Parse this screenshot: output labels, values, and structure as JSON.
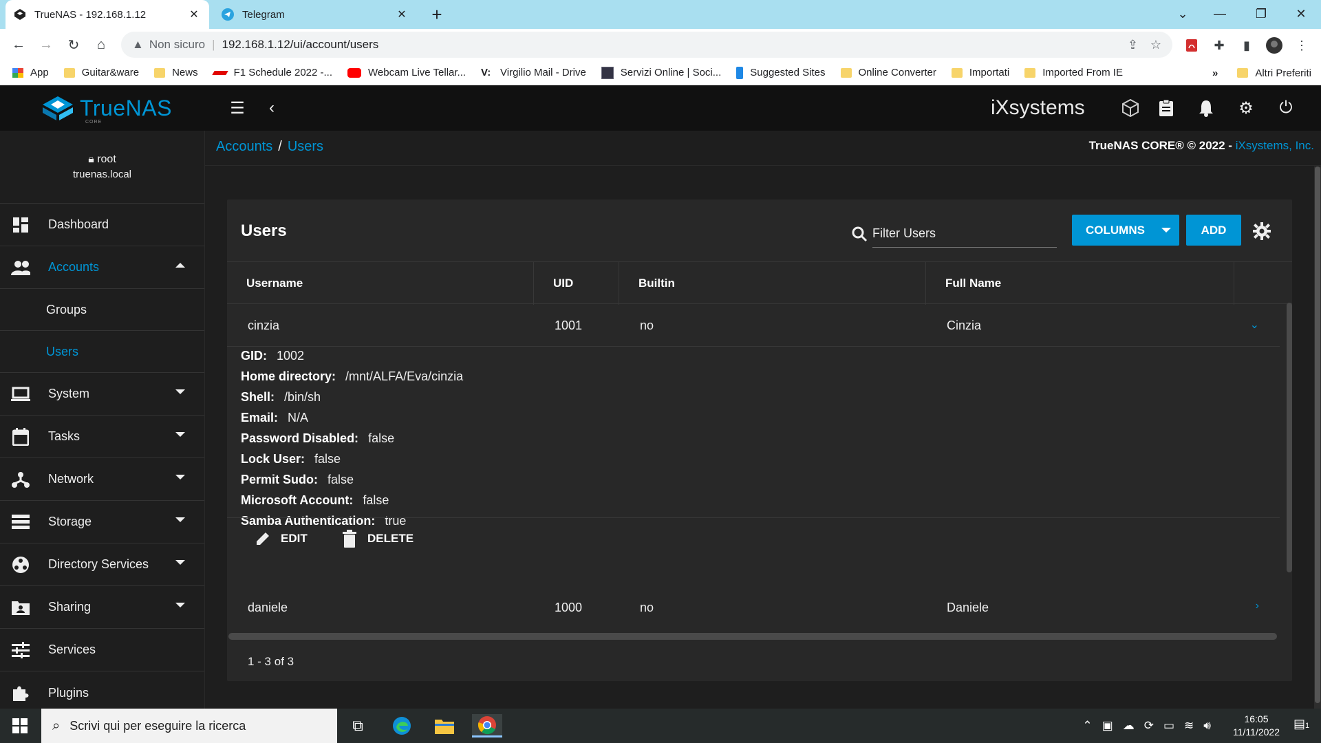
{
  "browser": {
    "tabs": [
      {
        "title": "TrueNAS - 192.168.1.12",
        "active": true
      },
      {
        "title": "Telegram",
        "active": false
      }
    ],
    "security_label": "Non sicuro",
    "url": "192.168.1.12/ui/account/users",
    "bookmarks": [
      {
        "label": "App",
        "icon": "apps-grid-icon"
      },
      {
        "label": "Guitar&ware",
        "icon": "folder-icon"
      },
      {
        "label": "News",
        "icon": "folder-icon"
      },
      {
        "label": "F1 Schedule 2022 -...",
        "icon": "f1-icon"
      },
      {
        "label": "Webcam Live Tellar...",
        "icon": "youtube-icon"
      },
      {
        "label": "Virgilio Mail - Drive",
        "icon": "virgilio-icon"
      },
      {
        "label": "Servizi Online | Soci...",
        "icon": "site-icon"
      },
      {
        "label": "Suggested Sites",
        "icon": "bing-icon"
      },
      {
        "label": "Online Converter",
        "icon": "folder-icon"
      },
      {
        "label": "Importati",
        "icon": "folder-icon"
      },
      {
        "label": "Imported From IE",
        "icon": "folder-icon"
      }
    ],
    "bookmarks_overflow": "»",
    "other_bookmarks": "Altri Preferiti"
  },
  "app": {
    "logo_text": "TrueNAS",
    "logo_sub": "CORE",
    "vendor": "iXsystems",
    "user": "root",
    "host": "truenas.local",
    "breadcrumb": [
      "Accounts",
      "Users"
    ],
    "copyright_prefix": "TrueNAS CORE® © 2022 -",
    "copyright_link": "iXsystems, Inc."
  },
  "sidebar": {
    "items": [
      {
        "label": "Dashboard",
        "icon": "dashboard-icon"
      },
      {
        "label": "Accounts",
        "icon": "accounts-icon",
        "expanded": true
      },
      {
        "label": "Groups",
        "sub": true
      },
      {
        "label": "Users",
        "sub": true,
        "active": true
      },
      {
        "label": "System",
        "icon": "laptop-icon"
      },
      {
        "label": "Tasks",
        "icon": "calendar-icon"
      },
      {
        "label": "Network",
        "icon": "network-icon"
      },
      {
        "label": "Storage",
        "icon": "storage-icon"
      },
      {
        "label": "Directory Services",
        "icon": "directory-icon"
      },
      {
        "label": "Sharing",
        "icon": "sharing-icon"
      },
      {
        "label": "Services",
        "icon": "services-icon"
      },
      {
        "label": "Plugins",
        "icon": "plugins-icon"
      }
    ]
  },
  "users_card": {
    "title": "Users",
    "filter_placeholder": "Filter Users",
    "columns_button": "COLUMNS",
    "add_button": "ADD",
    "headers": [
      "Username",
      "UID",
      "Builtin",
      "Full Name"
    ],
    "rows": [
      {
        "username": "cinzia",
        "uid": "1001",
        "builtin": "no",
        "full_name": "Cinzia"
      },
      {
        "username": "daniele",
        "uid": "1000",
        "builtin": "no",
        "full_name": "Daniele"
      }
    ],
    "details": [
      {
        "key": "GID:",
        "value": "1002"
      },
      {
        "key": "Home directory:",
        "value": "/mnt/ALFA/Eva/cinzia"
      },
      {
        "key": "Shell:",
        "value": "/bin/sh"
      },
      {
        "key": "Email:",
        "value": "N/A"
      },
      {
        "key": "Password Disabled:",
        "value": "false"
      },
      {
        "key": "Lock User:",
        "value": "false"
      },
      {
        "key": "Permit Sudo:",
        "value": "false"
      },
      {
        "key": "Microsoft Account:",
        "value": "false"
      },
      {
        "key": "Samba Authentication:",
        "value": "true"
      }
    ],
    "edit_label": "EDIT",
    "delete_label": "DELETE",
    "pager": "1 - 3 of 3"
  },
  "taskbar": {
    "search_placeholder": "Scrivi qui per eseguire la ricerca",
    "time": "16:05",
    "date": "11/11/2022",
    "notifications": "1"
  },
  "colors": {
    "accent": "#0095d5",
    "background": "#1e1e1e",
    "card": "#282828",
    "topbar": "#111111"
  }
}
